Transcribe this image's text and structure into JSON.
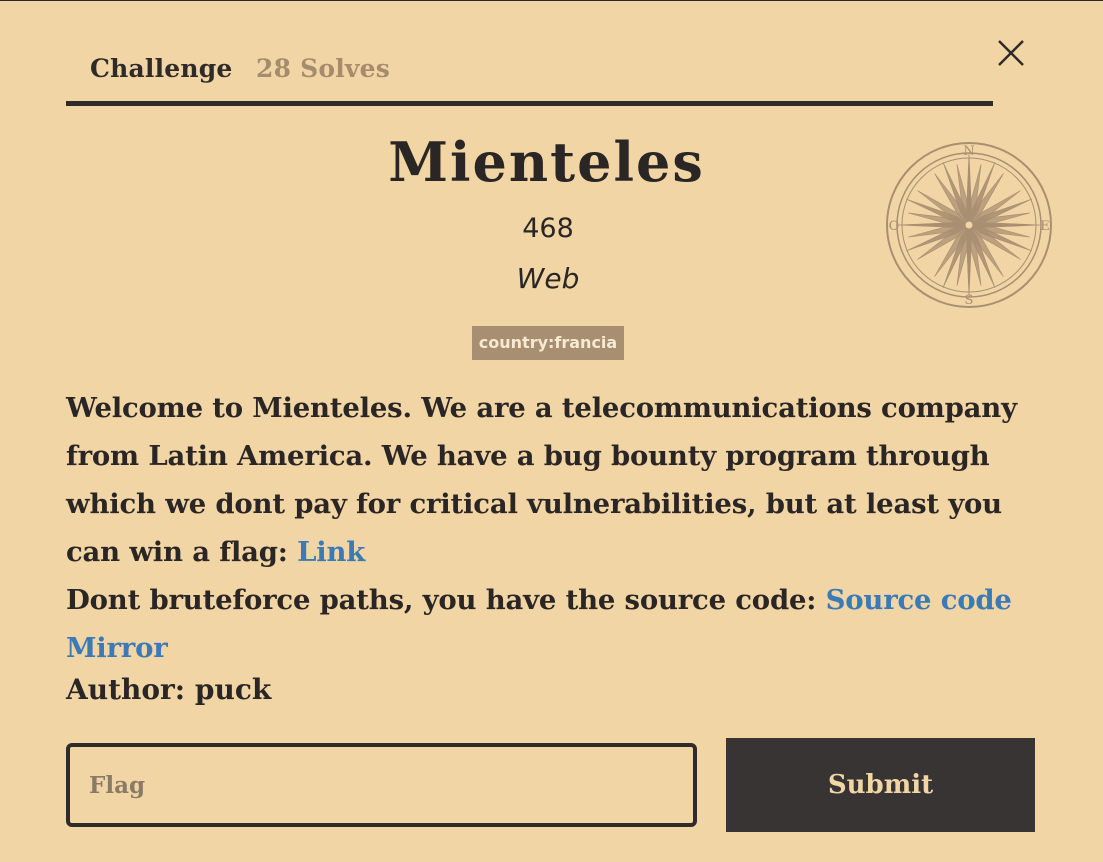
{
  "tabs": [
    {
      "label": "Challenge"
    },
    {
      "label": "28 Solves"
    }
  ],
  "challenge": {
    "name": "Mienteles",
    "points": "468",
    "category": "Web",
    "tag": "country:francia"
  },
  "description": {
    "line1": "Welcome to Mienteles. We are a telecommunications company from Latin America. We have a bug bounty program through which we dont pay for critical vulnerabilities, but at least you can win a flag: ",
    "link1": "Link",
    "line2": "Dont bruteforce paths, you have the source code: ",
    "link2": "Source code",
    "link3": "Mirror"
  },
  "author": {
    "label": "Author: ",
    "name": "puck"
  },
  "form": {
    "flag_placeholder": "Flag",
    "submit_label": "Submit"
  },
  "compass": {
    "letters": {
      "n": "N",
      "e": "E",
      "s": "S",
      "w": "O"
    },
    "color": "#a88f72"
  },
  "colors": {
    "background": "#f1d5a4",
    "text": "#2b2626",
    "link": "#3b7ab8",
    "tag_bg": "#a88f72",
    "button_bg": "#383434"
  }
}
